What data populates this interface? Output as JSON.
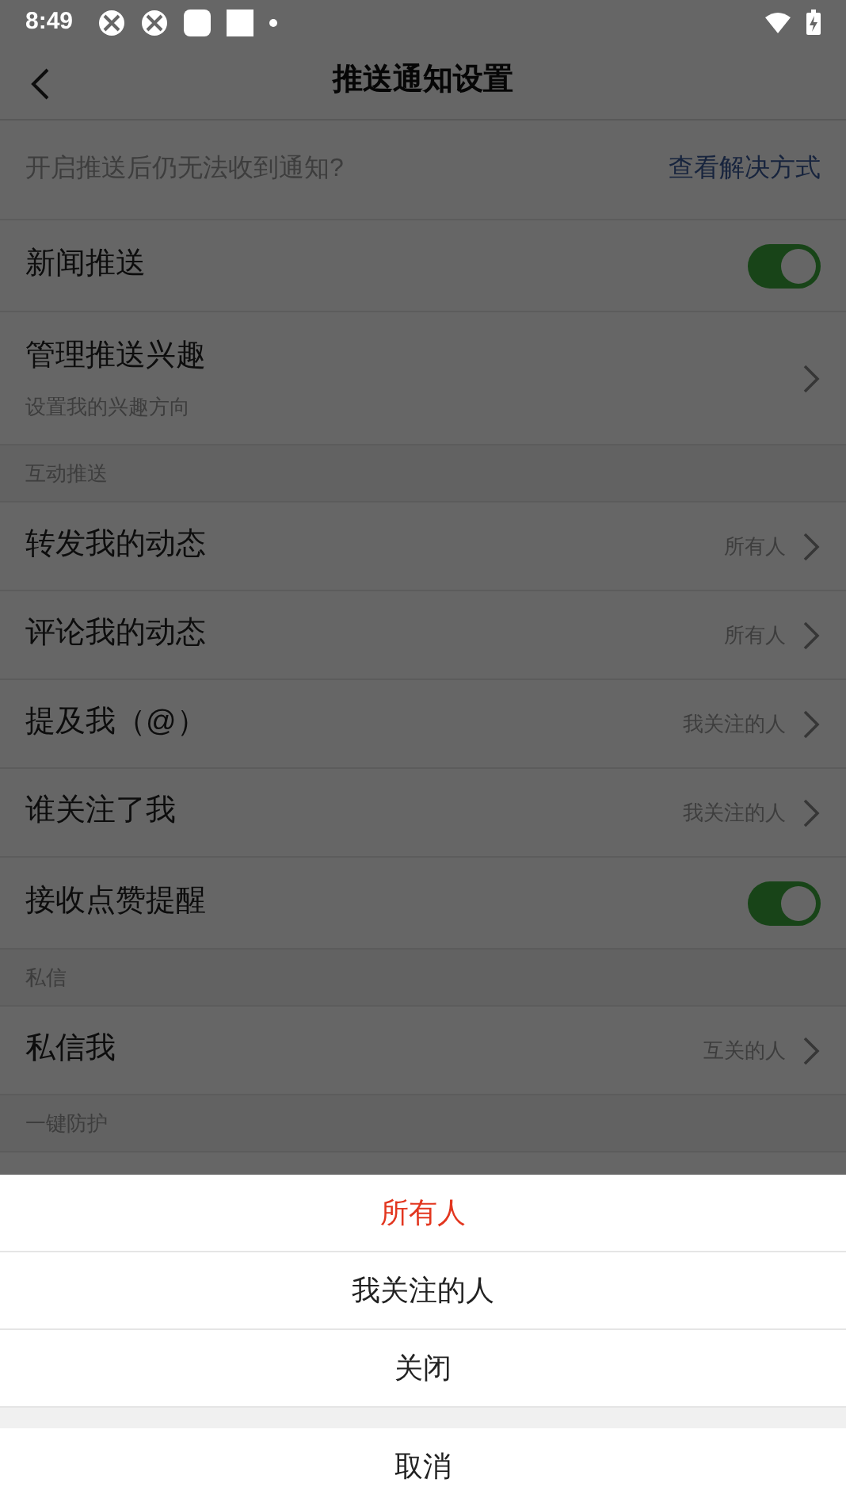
{
  "status_bar": {
    "time": "8:49"
  },
  "header": {
    "title": "推送通知设置"
  },
  "help": {
    "text": "开启推送后仍无法收到通知?",
    "link": "查看解决方式"
  },
  "items": [
    {
      "kind": "toggle",
      "label": "新闻推送",
      "on": true
    },
    {
      "kind": "nav",
      "label": "管理推送兴趣",
      "subtitle": "设置我的兴趣方向"
    },
    {
      "kind": "section",
      "label": "互动推送"
    },
    {
      "kind": "nav",
      "label": "转发我的动态",
      "value": "所有人"
    },
    {
      "kind": "nav",
      "label": "评论我的动态",
      "value": "所有人"
    },
    {
      "kind": "nav",
      "label": "提及我（@）",
      "value": "我关注的人"
    },
    {
      "kind": "nav",
      "label": "谁关注了我",
      "value": "我关注的人"
    },
    {
      "kind": "toggle",
      "label": "接收点赞提醒",
      "on": true
    },
    {
      "kind": "section",
      "label": "私信"
    },
    {
      "kind": "nav",
      "label": "私信我",
      "value": "互关的人"
    },
    {
      "kind": "section",
      "label": "一键防护"
    }
  ],
  "sheet": {
    "options": [
      {
        "label": "所有人",
        "selected": true
      },
      {
        "label": "我关注的人",
        "selected": false
      },
      {
        "label": "关闭",
        "selected": false
      }
    ],
    "cancel": "取消"
  }
}
